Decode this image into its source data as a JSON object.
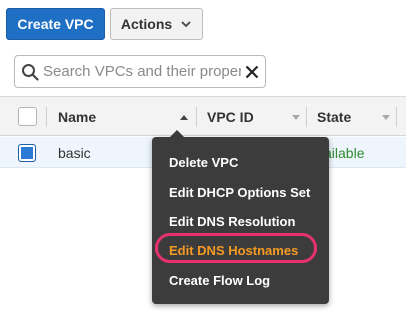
{
  "toolbar": {
    "create_label": "Create VPC",
    "actions_label": "Actions",
    "actions_chevron_icon": "chevron-down-icon"
  },
  "search": {
    "placeholder": "Search VPCs and their proper",
    "value": "",
    "search_icon": "magnifier-icon",
    "clear_icon": "close-icon"
  },
  "table": {
    "columns": [
      "Name",
      "VPC ID",
      "State"
    ],
    "rows": [
      {
        "selected": true,
        "name": "basic",
        "vpc_id": "",
        "state": "vailable"
      }
    ]
  },
  "context_menu": {
    "items": [
      {
        "label": "Delete VPC",
        "highlighted": false
      },
      {
        "label": "Edit DHCP Options Set",
        "highlighted": false
      },
      {
        "label": "Edit DNS Resolution",
        "highlighted": false
      },
      {
        "label": "Edit DNS Hostnames",
        "highlighted": true
      },
      {
        "label": "Create Flow Log",
        "highlighted": false
      }
    ]
  },
  "colors": {
    "primary_button": "#1f6fc5",
    "menu_background": "#3c3c3c",
    "menu_highlight_text": "#f59a23",
    "annotation_ring": "#e8326f",
    "state_available": "#2e8b2e",
    "selected_row": "#eef5fd"
  }
}
